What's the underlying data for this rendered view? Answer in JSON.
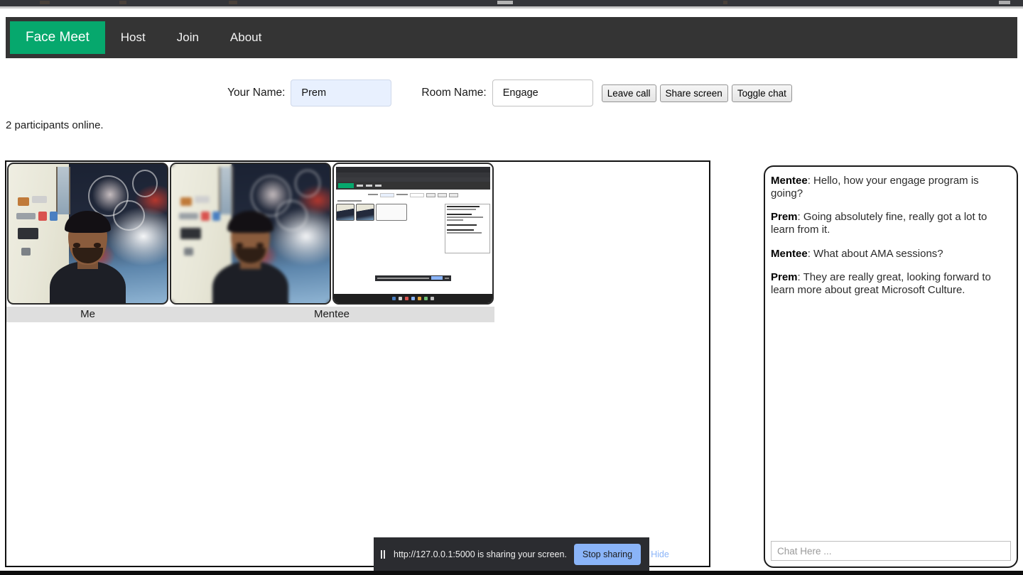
{
  "browser": {
    "sharing_notification": {
      "pause_icon": "pause-icon",
      "text": "http://127.0.0.1:5000 is sharing your screen.",
      "stop_label": "Stop sharing",
      "hide_label": "Hide"
    }
  },
  "navbar": {
    "brand": "Face Meet",
    "brand_color": "#06a86d",
    "background": "#343434",
    "links": [
      {
        "label": "Host"
      },
      {
        "label": "Join"
      },
      {
        "label": "About"
      }
    ]
  },
  "controls": {
    "name_label": "Your Name:",
    "name_value": "Prem",
    "name_placeholder": "Your Name",
    "room_label": "Room Name:",
    "room_value": "Engage",
    "room_placeholder": "Room Name",
    "buttons": [
      {
        "label": "Leave call"
      },
      {
        "label": "Share screen"
      },
      {
        "label": "Toggle chat"
      }
    ]
  },
  "status": {
    "participants": "2 participants online."
  },
  "stage": {
    "tiles": [
      {
        "label": "Me",
        "videos": [
          "webcam"
        ]
      },
      {
        "label": "Mentee",
        "videos": [
          "webcam",
          "screen-share"
        ]
      }
    ]
  },
  "chat": {
    "messages": [
      {
        "who": "Mentee",
        "text": "Hello, how your engage program is going?"
      },
      {
        "who": "Prem",
        "text": "Going absolutely fine, really got a lot to learn from it."
      },
      {
        "who": "Mentee",
        "text": "What about AMA sessions?"
      },
      {
        "who": "Prem",
        "text": "They are really great, looking forward to learn more about great Microsoft Culture."
      }
    ],
    "input_placeholder": "Chat Here ...",
    "input_value": ""
  }
}
